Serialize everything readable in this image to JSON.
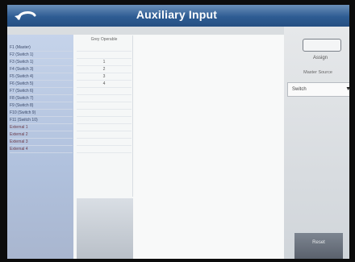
{
  "window": {
    "title": "Auxiliary Input"
  },
  "table": {
    "column_header": "Grey Operable",
    "rows": [
      {
        "label": "F1 (Master)",
        "value": ""
      },
      {
        "label": "F2 (Switch 1)",
        "value": ""
      },
      {
        "label": "F3 (Switch 1)",
        "value": "1"
      },
      {
        "label": "F4 (Switch 3)",
        "value": "2"
      },
      {
        "label": "F5 (Switch 4)",
        "value": "3"
      },
      {
        "label": "F6 (Switch 5)",
        "value": "4"
      },
      {
        "label": "F7 (Switch 6)",
        "value": ""
      },
      {
        "label": "F8 (Switch 7)",
        "value": ""
      },
      {
        "label": "F9 (Switch 8)",
        "value": ""
      },
      {
        "label": "F10 (Switch 9)",
        "value": ""
      },
      {
        "label": "F11 (Switch 10)",
        "value": ""
      },
      {
        "label": "External 1",
        "value": ""
      },
      {
        "label": "External 2",
        "value": ""
      },
      {
        "label": "External 3",
        "value": ""
      },
      {
        "label": "External 4",
        "value": ""
      }
    ]
  },
  "right_panel": {
    "assign_label": "Assign",
    "master_source_label": "Master Source",
    "master_source_value": "Switch",
    "reset_label": "Reset"
  },
  "icons": {
    "back": "back-arrow-icon",
    "dropdown": "chevron-down-icon"
  },
  "colors": {
    "title_bar": "#2e5c93",
    "sidebar": "#b0c1dd"
  }
}
